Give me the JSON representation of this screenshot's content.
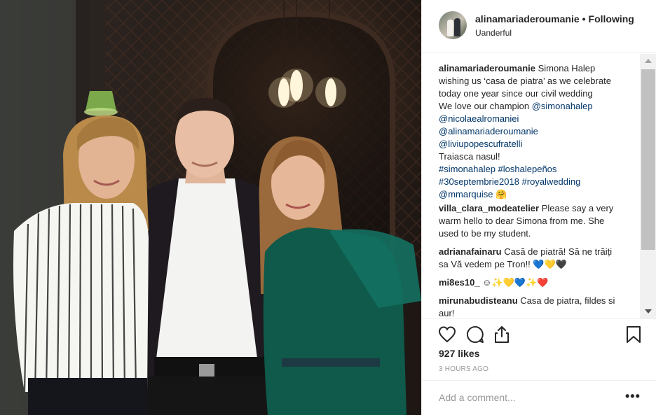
{
  "post": {
    "username": "alinamariaderoumanie",
    "separator": "•",
    "follow_status": "Following",
    "location": "Uanderful",
    "likes": "927 likes",
    "time_ago": "3 HOURS AGO",
    "photo_alt": "Four... three people posing in a dim restaurant"
  },
  "caption": {
    "user": "alinamariaderoumanie",
    "text1": " Simona Halep wishing us ‘casa de piatra’ as we celebrate today one year since our civil wedding",
    "text2": "We love our champion ",
    "mention1": "@simonahalep",
    "mention2": "@nicolaealromaniei",
    "mention3": "@alinamariaderoumanie",
    "mention4": "@liviupopescufratelli",
    "text3": "Traiasca nasul!",
    "hashtags1": "#simonahalep #loshalepeños",
    "hashtags2": "#30septembrie2018 #royalwedding",
    "mention5": "@mmarquise",
    "emoji": "🤗"
  },
  "comments": [
    {
      "user": "villa_clara_modeatelier",
      "text": " Please say a very warm hello to dear Simona from me. She used to be my student."
    },
    {
      "user": "adrianafainaru",
      "text": " Casă de piatră! Să ne trăiți sa Vă vedem pe Tron!! 💙💛🖤"
    },
    {
      "user": "mi8es10_",
      "text": " ☺✨💛💙✨❤️"
    },
    {
      "user": "mirunabudisteanu",
      "text": " Casa de piatra, fildes si aur!"
    }
  ],
  "composer": {
    "placeholder": "Add a comment..."
  },
  "more_label": "•••",
  "icons": [
    "heart-icon",
    "comment-icon",
    "share-icon",
    "bookmark-icon"
  ],
  "colors": {
    "link": "#003569",
    "muted": "#999999",
    "border": "#efefef"
  }
}
